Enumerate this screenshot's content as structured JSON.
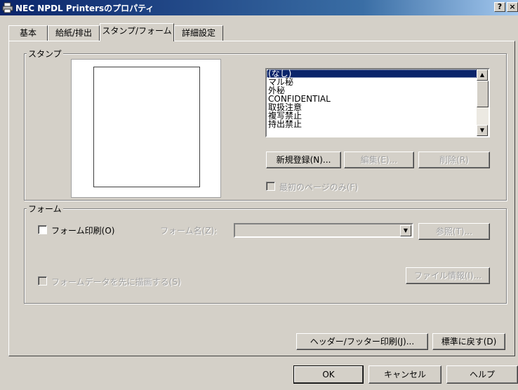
{
  "window": {
    "title": "NEC NPDL Printersのプロパティ",
    "help_button": "?",
    "close_button": "×"
  },
  "tabs": [
    {
      "label": "基本"
    },
    {
      "label": "給紙/排出"
    },
    {
      "label": "スタンプ/フォーム"
    },
    {
      "label": "詳細設定"
    }
  ],
  "stamp": {
    "group_label": "スタンプ",
    "items": [
      "(なし)",
      "マル秘",
      "外秘",
      "CONFIDENTIAL",
      "取扱注意",
      "複写禁止",
      "持出禁止"
    ],
    "selected_index": 0,
    "new_button": "新規登録(N)...",
    "edit_button": "編集(E)...",
    "delete_button": "削除(R)",
    "first_page_only_label": "最初のページのみ(F)"
  },
  "form": {
    "group_label": "フォーム",
    "print_label": "フォーム印刷(O)",
    "name_label": "フォーム名(Z):",
    "name_value": "",
    "browse_button": "参照(T)...",
    "draw_first_label": "フォームデータを先に描画する(S)",
    "file_info_button": "ファイル情報(I)..."
  },
  "bottom": {
    "header_footer_button": "ヘッダー/フッター印刷(J)...",
    "defaults_button": "標準に戻す(D)"
  },
  "dialog": {
    "ok": "OK",
    "cancel": "キャンセル",
    "help": "ヘルプ"
  },
  "colors": {
    "titlebar": "#0a246a",
    "face": "#d4d0c8",
    "selection": "#0a246a"
  }
}
